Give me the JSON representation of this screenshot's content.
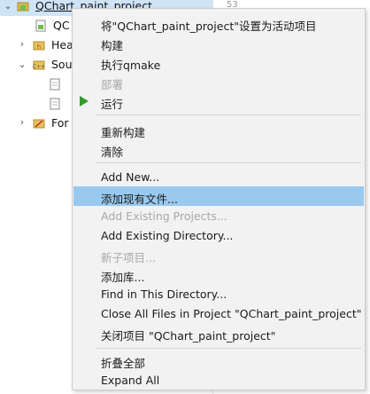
{
  "tree": {
    "project_name": "QChart_paint_project",
    "pro_file_prefix": "QC",
    "headers_prefix": "Hea",
    "sources_prefix": "Sou",
    "forms_prefix": "For",
    "editor_line_number": "53"
  },
  "context_menu": {
    "items": [
      {
        "label": "将\"QChart_paint_project\"设置为活动项目",
        "enabled": true
      },
      {
        "label": "构建",
        "enabled": true
      },
      {
        "label": "执行qmake",
        "enabled": true
      },
      {
        "label": "部署",
        "enabled": false
      },
      {
        "label": "运行",
        "enabled": true,
        "icon": "run-play-icon"
      },
      {
        "label": "重新构建",
        "enabled": true
      },
      {
        "label": "清除",
        "enabled": true
      },
      {
        "label": "Add New...",
        "enabled": true
      },
      {
        "label": "添加现有文件...",
        "enabled": true,
        "highlighted": true
      },
      {
        "label": "Add Existing Projects...",
        "enabled": false
      },
      {
        "label": "Add Existing Directory...",
        "enabled": true
      },
      {
        "label": "新子项目...",
        "enabled": false
      },
      {
        "label": "添加库...",
        "enabled": true
      },
      {
        "label": "Find in This Directory...",
        "enabled": true
      },
      {
        "label": "Close All Files in Project \"QChart_paint_project\"",
        "enabled": true
      },
      {
        "label": "关闭项目 \"QChart_paint_project\"",
        "enabled": true
      },
      {
        "label": "折叠全部",
        "enabled": true
      },
      {
        "label": "Expand All",
        "enabled": true
      }
    ]
  },
  "colors": {
    "highlight": "#99c9ef",
    "menu_background": "#f2f2f2",
    "disabled_text": "#a8a8a8",
    "run_icon": "#2e9d2e",
    "tree_selection": "#cfe4f7"
  }
}
